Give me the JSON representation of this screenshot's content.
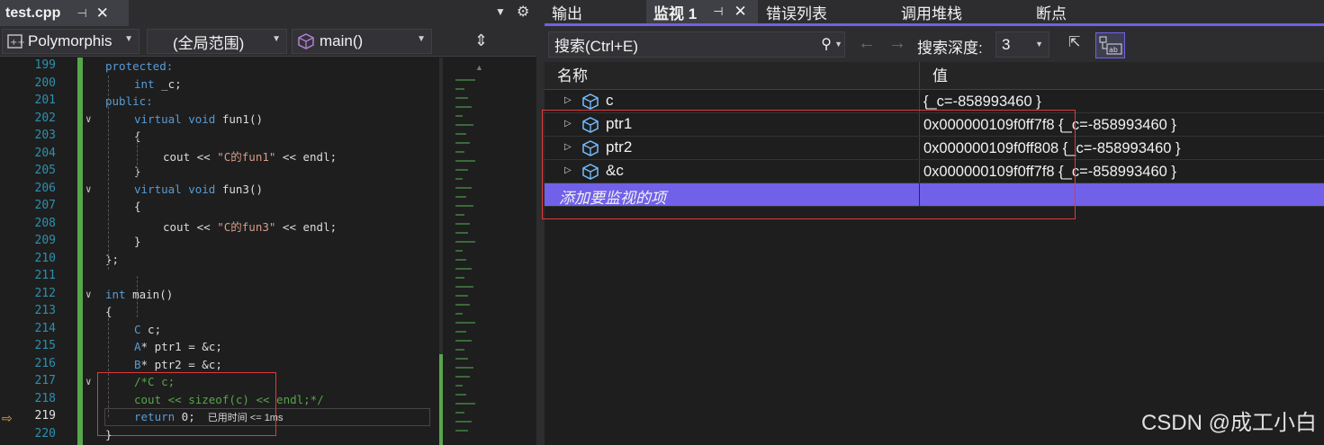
{
  "editor": {
    "tab": {
      "filename": "test.cpp",
      "pin": "⊣",
      "close": "✕"
    },
    "nav": {
      "project": "Polymorphis",
      "scope": "(全局范围)",
      "function": "main()"
    },
    "lines": [
      {
        "num": "199",
        "tokens": [
          {
            "t": "protected:",
            "c": "kw"
          }
        ]
      },
      {
        "num": "200",
        "tokens": [
          {
            "t": "int",
            "c": "kw"
          },
          {
            "t": " _c;",
            "c": "pl"
          }
        ]
      },
      {
        "num": "201",
        "tokens": [
          {
            "t": "public:",
            "c": "kw"
          }
        ]
      },
      {
        "num": "202",
        "tokens": [
          {
            "t": "virtual void",
            "c": "kw"
          },
          {
            "t": " fun1()",
            "c": "pl"
          }
        ]
      },
      {
        "num": "203",
        "tokens": [
          {
            "t": "{",
            "c": "pl"
          }
        ]
      },
      {
        "num": "204",
        "tokens": [
          {
            "t": "cout << ",
            "c": "pl"
          },
          {
            "t": "\"C的fun1\"",
            "c": "str"
          },
          {
            "t": " << endl;",
            "c": "pl"
          }
        ]
      },
      {
        "num": "205",
        "tokens": [
          {
            "t": "}",
            "c": "pl"
          }
        ]
      },
      {
        "num": "206",
        "tokens": [
          {
            "t": "virtual void",
            "c": "kw"
          },
          {
            "t": " fun3()",
            "c": "pl"
          }
        ]
      },
      {
        "num": "207",
        "tokens": [
          {
            "t": "{",
            "c": "pl"
          }
        ]
      },
      {
        "num": "208",
        "tokens": [
          {
            "t": "cout << ",
            "c": "pl"
          },
          {
            "t": "\"C的fun3\"",
            "c": "str"
          },
          {
            "t": " << endl;",
            "c": "pl"
          }
        ]
      },
      {
        "num": "209",
        "tokens": [
          {
            "t": "}",
            "c": "pl"
          }
        ]
      },
      {
        "num": "210",
        "tokens": [
          {
            "t": "};",
            "c": "pl"
          }
        ]
      },
      {
        "num": "211",
        "tokens": []
      },
      {
        "num": "212",
        "tokens": [
          {
            "t": "int",
            "c": "kw"
          },
          {
            "t": " main()",
            "c": "pl"
          }
        ]
      },
      {
        "num": "213",
        "tokens": [
          {
            "t": "{",
            "c": "pl"
          }
        ]
      },
      {
        "num": "214",
        "tokens": [
          {
            "t": "C",
            "c": "kw"
          },
          {
            "t": " c;",
            "c": "pl"
          }
        ]
      },
      {
        "num": "215",
        "tokens": [
          {
            "t": "A",
            "c": "kw"
          },
          {
            "t": "* ptr1 = &c;",
            "c": "pl"
          }
        ]
      },
      {
        "num": "216",
        "tokens": [
          {
            "t": "B",
            "c": "kw"
          },
          {
            "t": "* ptr2 = &c;",
            "c": "pl"
          }
        ]
      },
      {
        "num": "217",
        "tokens": [
          {
            "t": "/*C c;",
            "c": "cm"
          }
        ]
      },
      {
        "num": "218",
        "tokens": [
          {
            "t": "cout << sizeof(c) << endl;*/",
            "c": "cm"
          }
        ]
      },
      {
        "num": "219",
        "tokens": [
          {
            "t": "return",
            "c": "kw"
          },
          {
            "t": " 0;",
            "c": "pl"
          }
        ]
      },
      {
        "num": "220",
        "tokens": [
          {
            "t": "}",
            "c": "pl"
          }
        ]
      }
    ],
    "perf_hint": "已用时间 <= 1ms"
  },
  "panel": {
    "tabs": [
      {
        "label": "输出"
      },
      {
        "label": "监视 1",
        "selected": true
      },
      {
        "label": "错误列表"
      },
      {
        "label": "调用堆栈"
      },
      {
        "label": "断点"
      }
    ],
    "search_placeholder": "搜索(Ctrl+E)",
    "depth_label": "搜索深度:",
    "depth_value": "3",
    "columns": {
      "name": "名称",
      "value": "值"
    },
    "rows": [
      {
        "name": "c",
        "value": "{_c=-858993460 }"
      },
      {
        "name": "ptr1",
        "value": "0x000000109f0ff7f8 {_c=-858993460 }"
      },
      {
        "name": "ptr2",
        "value": "0x000000109f0ff808 {_c=-858993460 }"
      },
      {
        "name": "&c",
        "value": "0x000000109f0ff7f8 {_c=-858993460 }"
      }
    ],
    "add_item": "添加要监视的项"
  },
  "watermark": "CSDN @成工小白",
  "colors": {
    "accent": "#7160e8",
    "keyword": "#569cd6",
    "string": "#d69d85",
    "comment": "#57a64a",
    "linenum": "#2b91af",
    "highlight_box": "#e03a3a"
  }
}
